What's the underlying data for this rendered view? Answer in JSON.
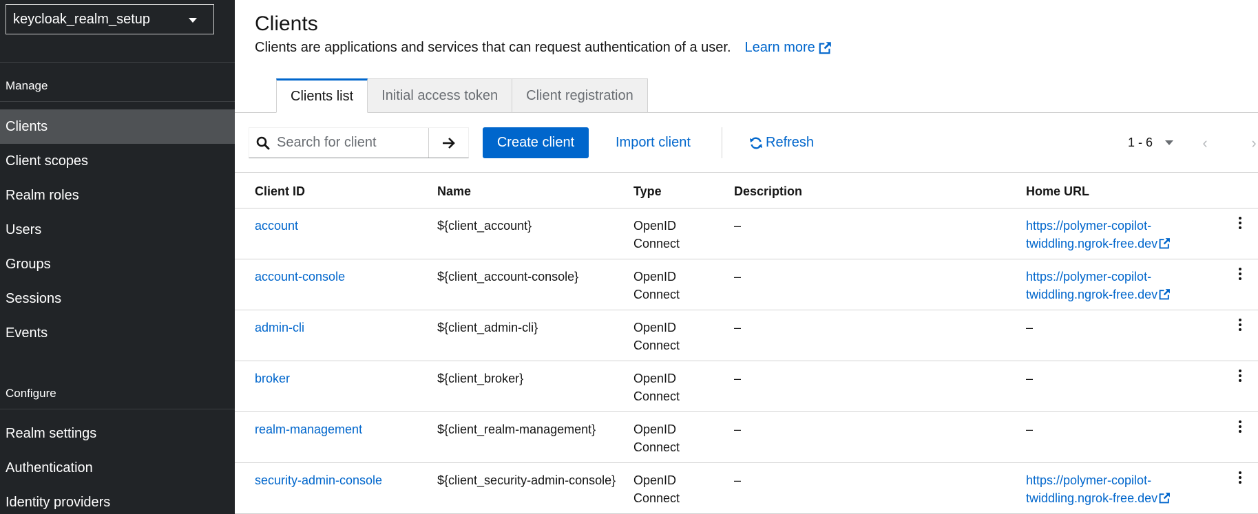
{
  "sidebar": {
    "realm": "keycloak_realm_setup",
    "sections": {
      "manage": "Manage",
      "configure": "Configure"
    },
    "manage_items": [
      {
        "label": "Clients",
        "active": true
      },
      {
        "label": "Client scopes"
      },
      {
        "label": "Realm roles"
      },
      {
        "label": "Users"
      },
      {
        "label": "Groups"
      },
      {
        "label": "Sessions"
      },
      {
        "label": "Events"
      }
    ],
    "configure_items": [
      {
        "label": "Realm settings"
      },
      {
        "label": "Authentication"
      },
      {
        "label": "Identity providers"
      }
    ]
  },
  "header": {
    "title": "Clients",
    "description": "Clients are applications and services that can request authentication of a user.",
    "learn_more": "Learn more"
  },
  "tabs": [
    {
      "label": "Clients list",
      "active": true
    },
    {
      "label": "Initial access token"
    },
    {
      "label": "Client registration"
    }
  ],
  "toolbar": {
    "search_placeholder": "Search for client",
    "create_label": "Create client",
    "import_label": "Import client",
    "refresh_label": "Refresh",
    "pagination": "1 - 6"
  },
  "table": {
    "columns": [
      "Client ID",
      "Name",
      "Type",
      "Description",
      "Home URL"
    ],
    "rows": [
      {
        "client_id": "account",
        "name": "${client_account}",
        "type_line1": "OpenID",
        "type_line2": "Connect",
        "description": "–",
        "home_url_line1": "https://polymer-copilot-",
        "home_url_line2": "twiddling.ngrok-free.dev",
        "has_url": true
      },
      {
        "client_id": "account-console",
        "name": "${client_account-console}",
        "type_line1": "OpenID",
        "type_line2": "Connect",
        "description": "–",
        "home_url_line1": "https://polymer-copilot-",
        "home_url_line2": "twiddling.ngrok-free.dev",
        "has_url": true
      },
      {
        "client_id": "admin-cli",
        "name": "${client_admin-cli}",
        "type_line1": "OpenID",
        "type_line2": "Connect",
        "description": "–",
        "home_url_line1": "–",
        "home_url_line2": "",
        "has_url": false
      },
      {
        "client_id": "broker",
        "name": "${client_broker}",
        "type_line1": "OpenID",
        "type_line2": "Connect",
        "description": "–",
        "home_url_line1": "–",
        "home_url_line2": "",
        "has_url": false
      },
      {
        "client_id": "realm-management",
        "name": "${client_realm-management}",
        "type_line1": "OpenID",
        "type_line2": "Connect",
        "description": "–",
        "home_url_line1": "–",
        "home_url_line2": "",
        "has_url": false
      },
      {
        "client_id": "security-admin-console",
        "name": "${client_security-admin-console}",
        "type_line1": "OpenID",
        "type_line2": "Connect",
        "description": "–",
        "home_url_line1": "https://polymer-copilot-",
        "home_url_line2": "twiddling.ngrok-free.dev",
        "has_url": true
      }
    ]
  },
  "colors": {
    "sidebar_bg": "#212427",
    "active_nav_bg": "#4f5255",
    "primary": "#0066cc"
  }
}
